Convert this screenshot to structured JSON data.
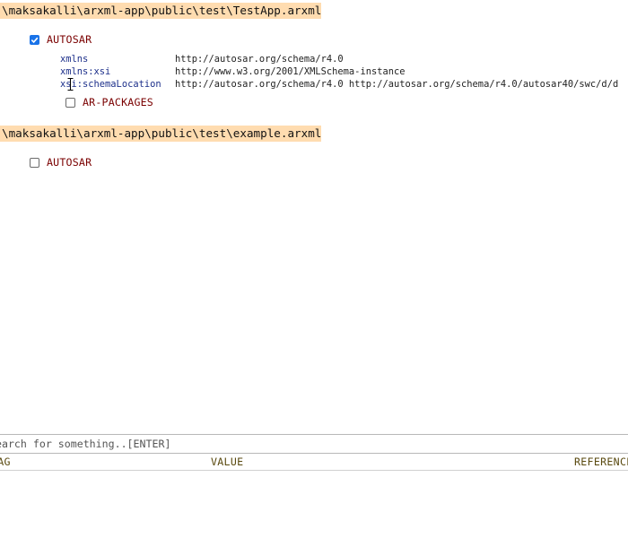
{
  "files": [
    {
      "path": "\\maksakalli\\arxml-app\\public\\test\\TestApp.arxml",
      "root": {
        "label": "AUTOSAR",
        "checked": true,
        "attributes": [
          {
            "name": "xmlns",
            "value": "http://autosar.org/schema/r4.0"
          },
          {
            "name": "xmlns:xsi",
            "value": "http://www.w3.org/2001/XMLSchema-instance"
          },
          {
            "name": "xsi:schemaLocation",
            "value": "http://autosar.org/schema/r4.0 http://autosar.org/schema/r4.0/autosar40/swc/d/d"
          }
        ],
        "children": [
          {
            "label": "AR-PACKAGES",
            "checked": false
          }
        ]
      }
    },
    {
      "path": "\\maksakalli\\arxml-app\\public\\test\\example.arxml",
      "root": {
        "label": "AUTOSAR",
        "checked": false
      }
    }
  ],
  "search": {
    "placeholder": "Search for something..[ENTER]",
    "value": ""
  },
  "table": {
    "columns": [
      "TAG",
      "VALUE",
      "REFERENCE"
    ]
  },
  "colors": {
    "path_highlight": "#ffdcb0",
    "node_label": "#7a0000",
    "attr_name": "#1c2f8a",
    "checkbox_checked": "#1a73e8"
  }
}
